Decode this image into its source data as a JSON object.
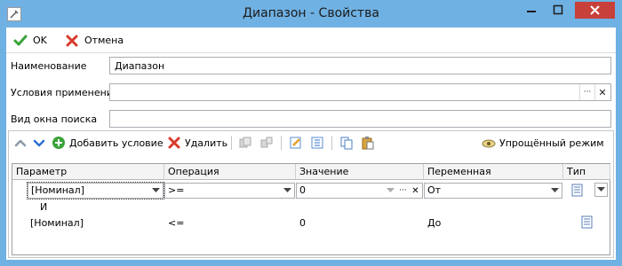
{
  "window": {
    "title": "Диапазон - Свойства"
  },
  "topbar": {
    "ok_label": "OK",
    "cancel_label": "Отмена"
  },
  "form": {
    "name_label": "Наименование",
    "name_value": "Диапазон",
    "conditions_label": "Условия применения",
    "conditions_value": "",
    "search_view_label": "Вид окна поиска",
    "search_view_value": "",
    "ellipsis": "···",
    "clear": "✕"
  },
  "toolbar": {
    "add_label": "Добавить условие",
    "delete_label": "Удалить",
    "simple_mode_label": "Упрощённый режим"
  },
  "grid": {
    "columns": [
      "Параметр",
      "Операция",
      "Значение",
      "Переменная",
      "Тип"
    ],
    "rows": [
      {
        "parameter": "[Номинал]",
        "operation": ">=",
        "value": "0",
        "variable": "От"
      },
      {
        "connector": "И"
      },
      {
        "parameter": "[Номинал]",
        "operation": "<=",
        "value": "0",
        "variable": "До"
      }
    ]
  },
  "colors": {
    "accent": "#6fb1e3",
    "close": "#c7403a",
    "ok_green": "#3aa33a",
    "cancel_red": "#d83a2a"
  }
}
